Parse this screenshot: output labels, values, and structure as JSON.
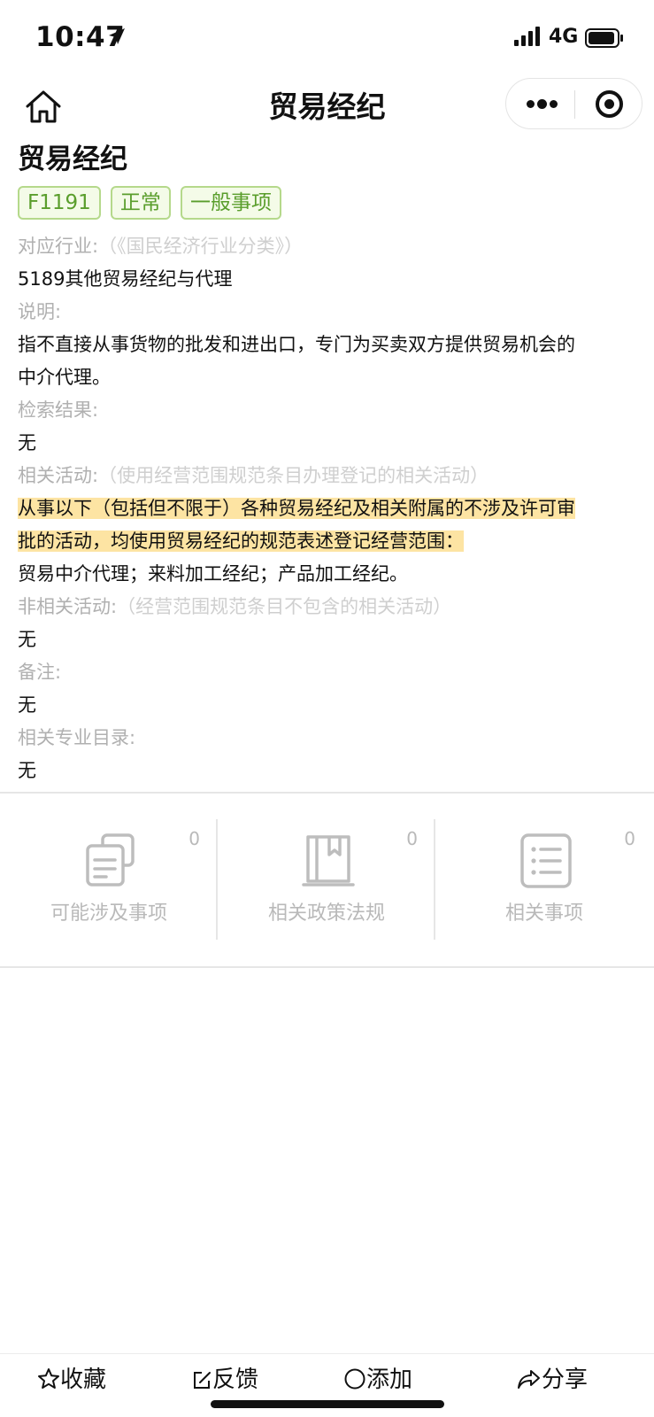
{
  "status_bar": {
    "time": "10:47",
    "network": "4G"
  },
  "nav": {
    "title": "贸易经纪"
  },
  "page": {
    "title": "贸易经纪",
    "tags": [
      "F1191",
      "正常",
      "一般事项"
    ]
  },
  "fields": {
    "industry_label": "对应行业:",
    "industry_hint": "（《国民经济行业分类》）",
    "industry_value": "5189其他贸易经纪与代理",
    "desc_label": "说明:",
    "desc_value_line1": "指不直接从事货物的批发和进出口，专门为买卖双方提供贸易机会的",
    "desc_value_line2": "中介代理。",
    "search_label": "检索结果:",
    "search_value": "无",
    "related_label": "相关活动:",
    "related_hint": "（使用经营范围规范条目办理登记的相关活动）",
    "related_highlight_line1": "从事以下（包括但不限于）各种贸易经纪及相关附属的不涉及许可审",
    "related_highlight_line2": "批的活动，均使用贸易经纪的规范表述登记经营范围：",
    "related_value": "贸易中介代理；来料加工经纪；产品加工经纪。",
    "nonrelated_label": "非相关活动:",
    "nonrelated_hint": "（经营范围规范条目不包含的相关活动）",
    "nonrelated_value": "无",
    "remark_label": "备注:",
    "remark_value": "无",
    "catalog_label": "相关专业目录:",
    "catalog_value": "无"
  },
  "stats": [
    {
      "label": "可能涉及事项",
      "count": "0",
      "icon": "documents-icon"
    },
    {
      "label": "相关政策法规",
      "count": "0",
      "icon": "book-icon"
    },
    {
      "label": "相关事项",
      "count": "0",
      "icon": "list-icon"
    }
  ],
  "toolbar": {
    "favorite": "收藏",
    "feedback": "反馈",
    "add": "添加",
    "share": "分享"
  },
  "colors": {
    "tag_text": "#5a9e2c",
    "tag_border": "#b5d98b",
    "highlight": "#fde4a3",
    "label_gray": "#b0b0b0"
  }
}
